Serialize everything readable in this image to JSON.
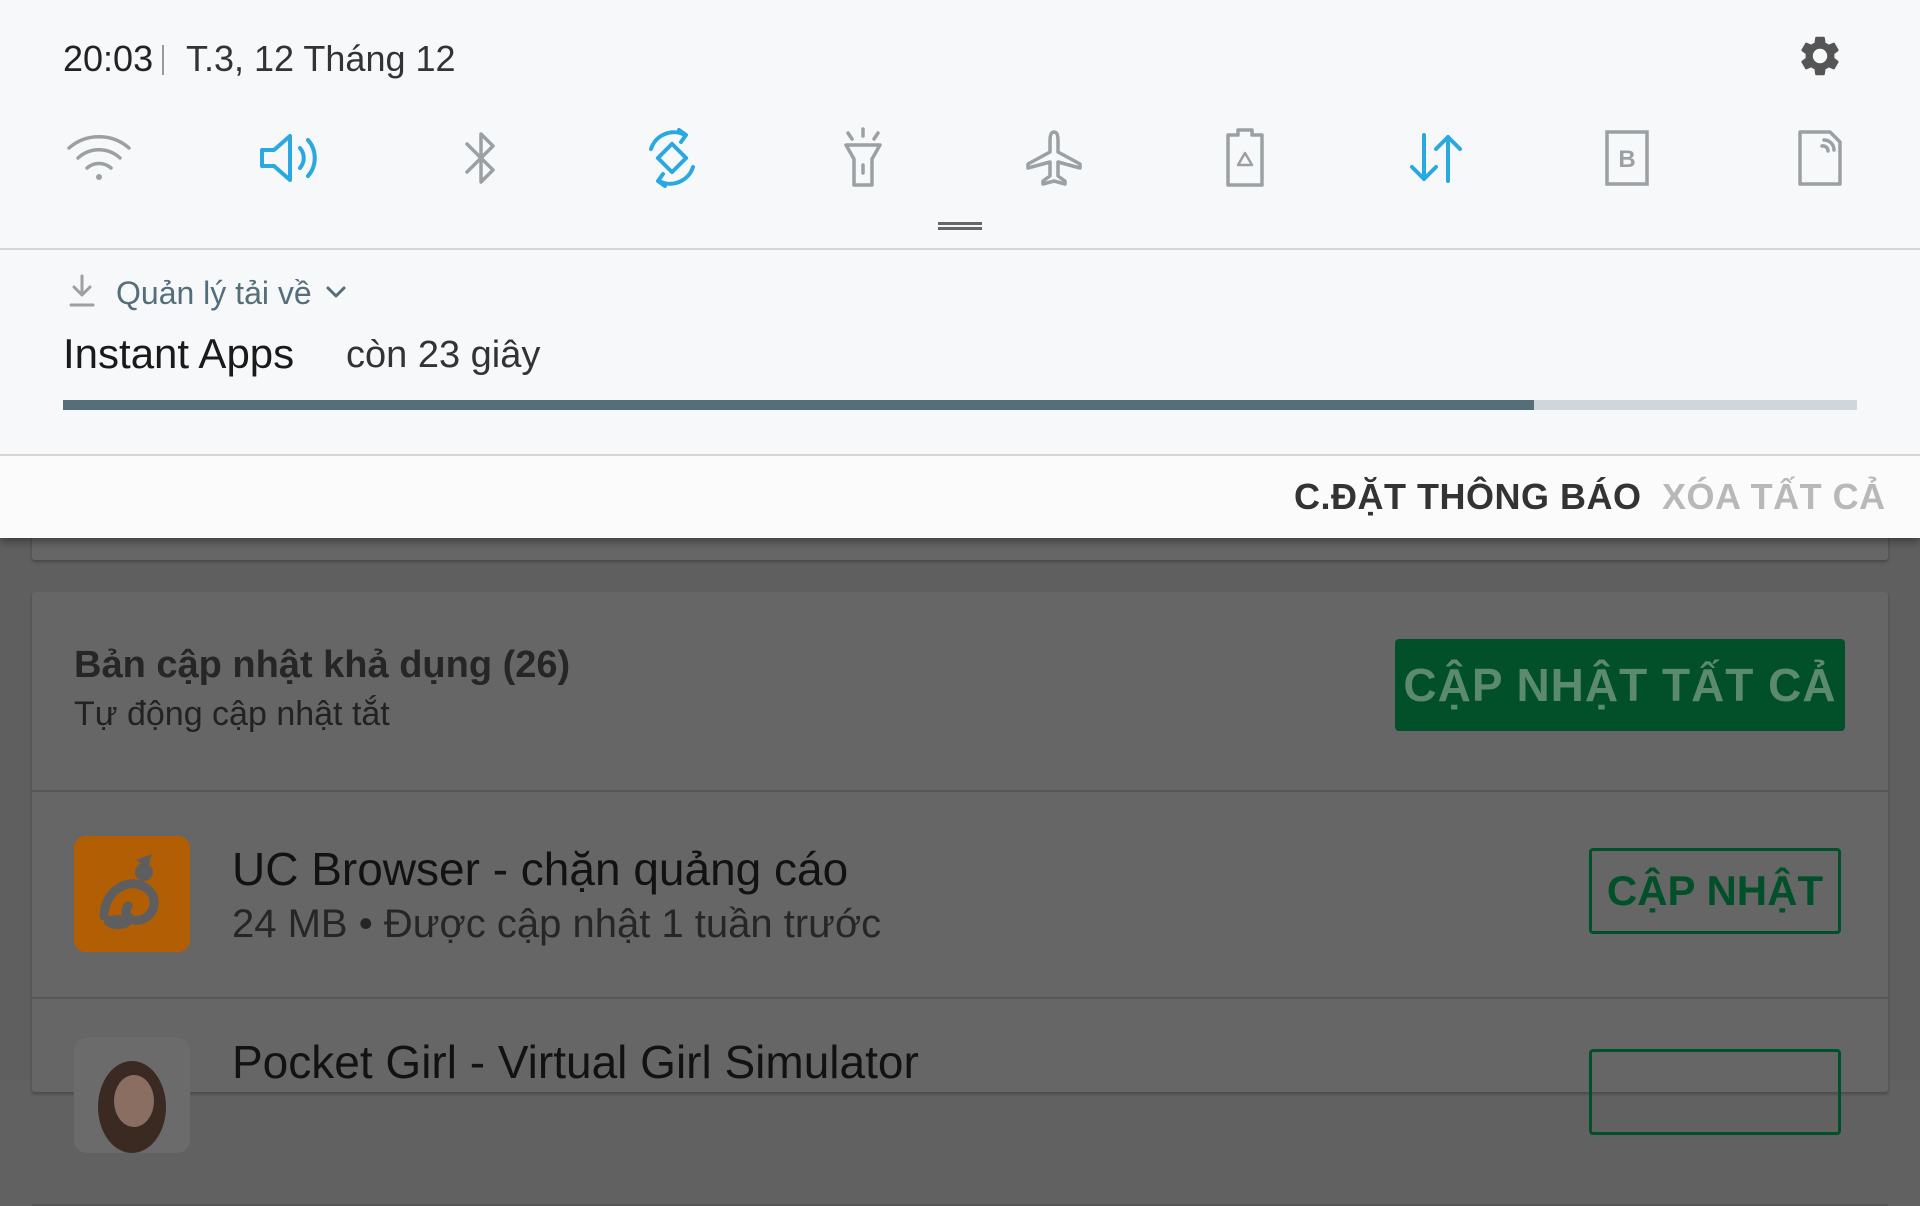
{
  "status_bar": {
    "time": "20:03",
    "date": "T.3, 12 Tháng 12",
    "settings_icon": "gear-icon"
  },
  "quick_settings": [
    {
      "name": "wifi",
      "icon": "wifi-icon",
      "active": false
    },
    {
      "name": "sound",
      "icon": "volume-icon",
      "active": true
    },
    {
      "name": "bluetooth",
      "icon": "bluetooth-icon",
      "active": false
    },
    {
      "name": "auto-rotate",
      "icon": "rotate-icon",
      "active": true
    },
    {
      "name": "flashlight",
      "icon": "flashlight-icon",
      "active": false
    },
    {
      "name": "airplane-mode",
      "icon": "airplane-icon",
      "active": false
    },
    {
      "name": "power-saving",
      "icon": "battery-recycle-icon",
      "active": false
    },
    {
      "name": "mobile-data",
      "icon": "data-arrows-icon",
      "active": true
    },
    {
      "name": "blue-light-filter",
      "icon": "b-box-icon",
      "active": false
    },
    {
      "name": "nfc",
      "icon": "nfc-icon",
      "active": false
    }
  ],
  "colors": {
    "active_icon": "#2aa8e0",
    "inactive_icon": "#9aa0a4",
    "progress": "#546e7a",
    "play_green": "#02502a"
  },
  "notification": {
    "app_name": "Quản lý tải về",
    "title": "Instant Apps",
    "status": "còn 23 giây",
    "progress_fraction": 0.82
  },
  "actions": {
    "settings": "C.ĐẶT THÔNG BÁO",
    "clear_all": "XÓA TẤT CẢ"
  },
  "background_app": {
    "updates_title": "Bản cập nhật khả dụng (26)",
    "auto_update": "Tự động cập nhật tắt",
    "update_all": "CẬP NHẬT TẤT CẢ",
    "apps": [
      {
        "name": "UC Browser - chặn quảng cáo",
        "meta": "24 MB • Được cập nhật 1 tuần trước",
        "button": "CẬP NHẬT"
      },
      {
        "name": "Pocket Girl - Virtual Girl Simulator",
        "meta": "",
        "button": ""
      }
    ]
  }
}
